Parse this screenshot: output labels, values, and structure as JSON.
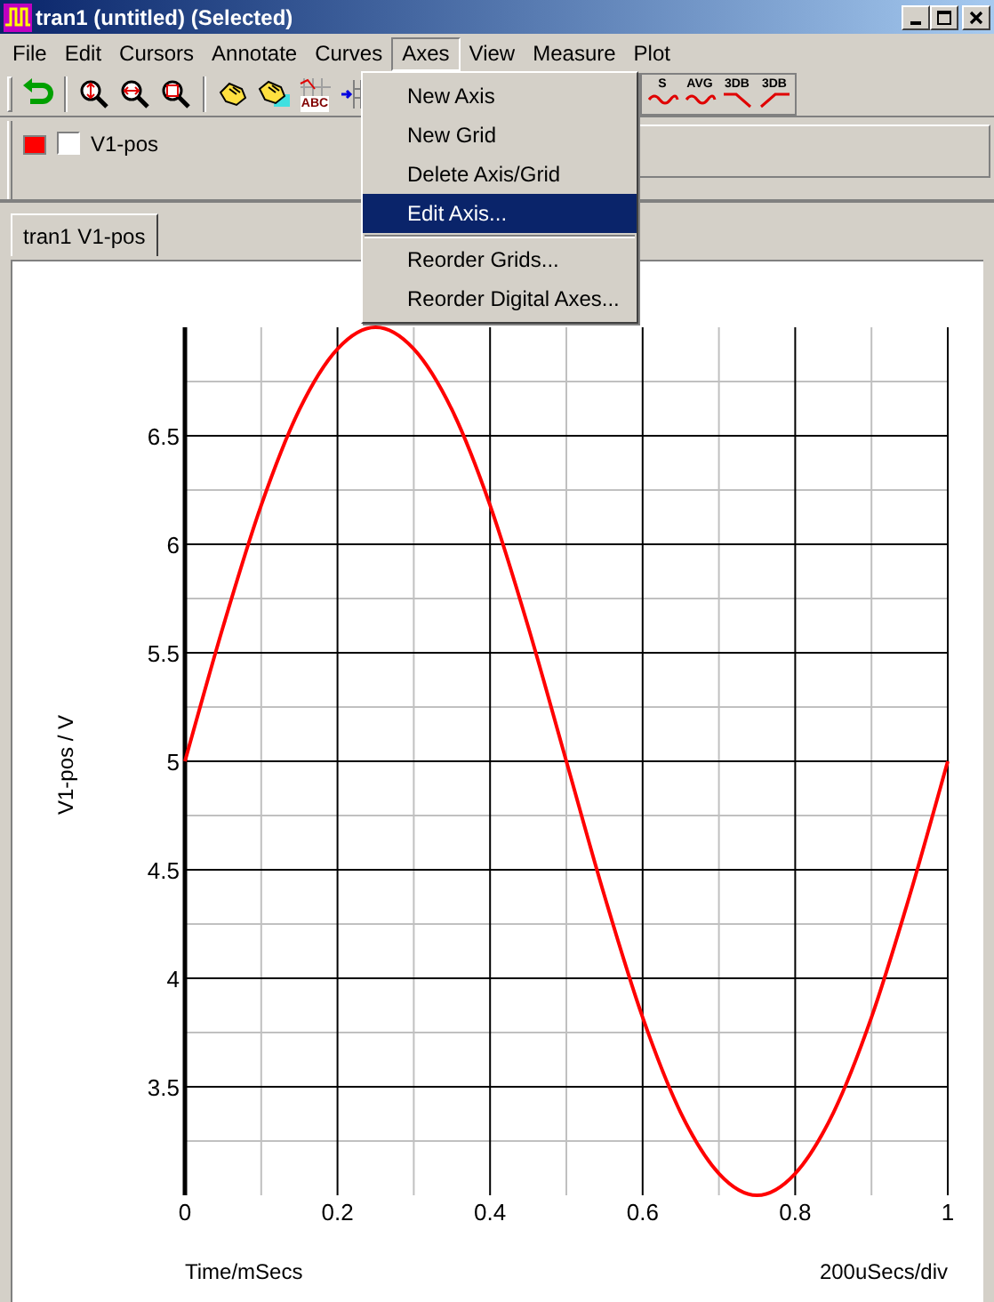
{
  "window": {
    "title": "tran1 (untitled) (Selected)"
  },
  "menu_bar": [
    {
      "label": "File",
      "selected": false
    },
    {
      "label": "Edit",
      "selected": false
    },
    {
      "label": "Cursors",
      "selected": false
    },
    {
      "label": "Annotate",
      "selected": false
    },
    {
      "label": "Curves",
      "selected": false
    },
    {
      "label": "Axes",
      "selected": true
    },
    {
      "label": "View",
      "selected": false
    },
    {
      "label": "Measure",
      "selected": false
    },
    {
      "label": "Plot",
      "selected": false
    }
  ],
  "toolbar_left": [
    {
      "kind": "undo"
    },
    {
      "kind": "separator"
    },
    {
      "kind": "zoom-vertical"
    },
    {
      "kind": "zoom-horizontal"
    },
    {
      "kind": "zoom-box"
    },
    {
      "kind": "separator"
    },
    {
      "kind": "hand"
    },
    {
      "kind": "hand-note"
    },
    {
      "kind": "text-tool",
      "label": "ABC"
    },
    {
      "kind": "cursor-grid"
    }
  ],
  "toolbar_right": [
    {
      "kind": "measure-wave",
      "label": "S"
    },
    {
      "kind": "measure-wave",
      "label": "AVG"
    },
    {
      "kind": "measure-fall",
      "label": "3DB"
    },
    {
      "kind": "measure-rise",
      "label": "3DB"
    }
  ],
  "legend": [
    {
      "label": "V1-pos",
      "color": "#ff0000",
      "checked": false
    }
  ],
  "axes_menu": [
    {
      "kind": "item",
      "label": "New Axis",
      "selected": false
    },
    {
      "kind": "item",
      "label": "New Grid",
      "selected": false
    },
    {
      "kind": "item",
      "label": "Delete Axis/Grid",
      "selected": false
    },
    {
      "kind": "item",
      "label": "Edit Axis...",
      "selected": true
    },
    {
      "kind": "separator"
    },
    {
      "kind": "item",
      "label": "Reorder Grids...",
      "selected": false
    },
    {
      "kind": "item",
      "label": "Reorder Digital Axes...",
      "selected": false
    }
  ],
  "tabs": [
    {
      "label": "tran1 V1-pos",
      "selected": true
    }
  ],
  "plot": {
    "scale_label": "200uSecs/div",
    "chart_data": {
      "type": "line",
      "xlabel": "Time/mSecs",
      "ylabel": "V1-pos / V",
      "x": [
        0,
        0.05,
        0.1,
        0.15,
        0.2,
        0.25,
        0.3,
        0.35,
        0.4,
        0.45,
        0.5,
        0.55,
        0.6,
        0.65,
        0.7,
        0.75,
        0.8,
        0.85,
        0.9,
        0.95,
        1
      ],
      "series": [
        {
          "color": "#ff0000",
          "values": [
            5,
            5.62,
            6.18,
            6.62,
            6.9,
            7,
            6.9,
            6.62,
            6.18,
            5.62,
            5,
            4.38,
            3.82,
            3.38,
            3.1,
            3,
            3.1,
            3.38,
            3.82,
            4.38,
            5
          ]
        }
      ],
      "grid": true,
      "xlim": [
        0,
        1
      ],
      "ylim": [
        3,
        7
      ],
      "xticks": [
        0,
        0.2,
        0.4,
        0.6,
        0.8,
        1
      ],
      "yticks": [
        3.5,
        4,
        4.5,
        5,
        5.5,
        6,
        6.5
      ]
    }
  }
}
